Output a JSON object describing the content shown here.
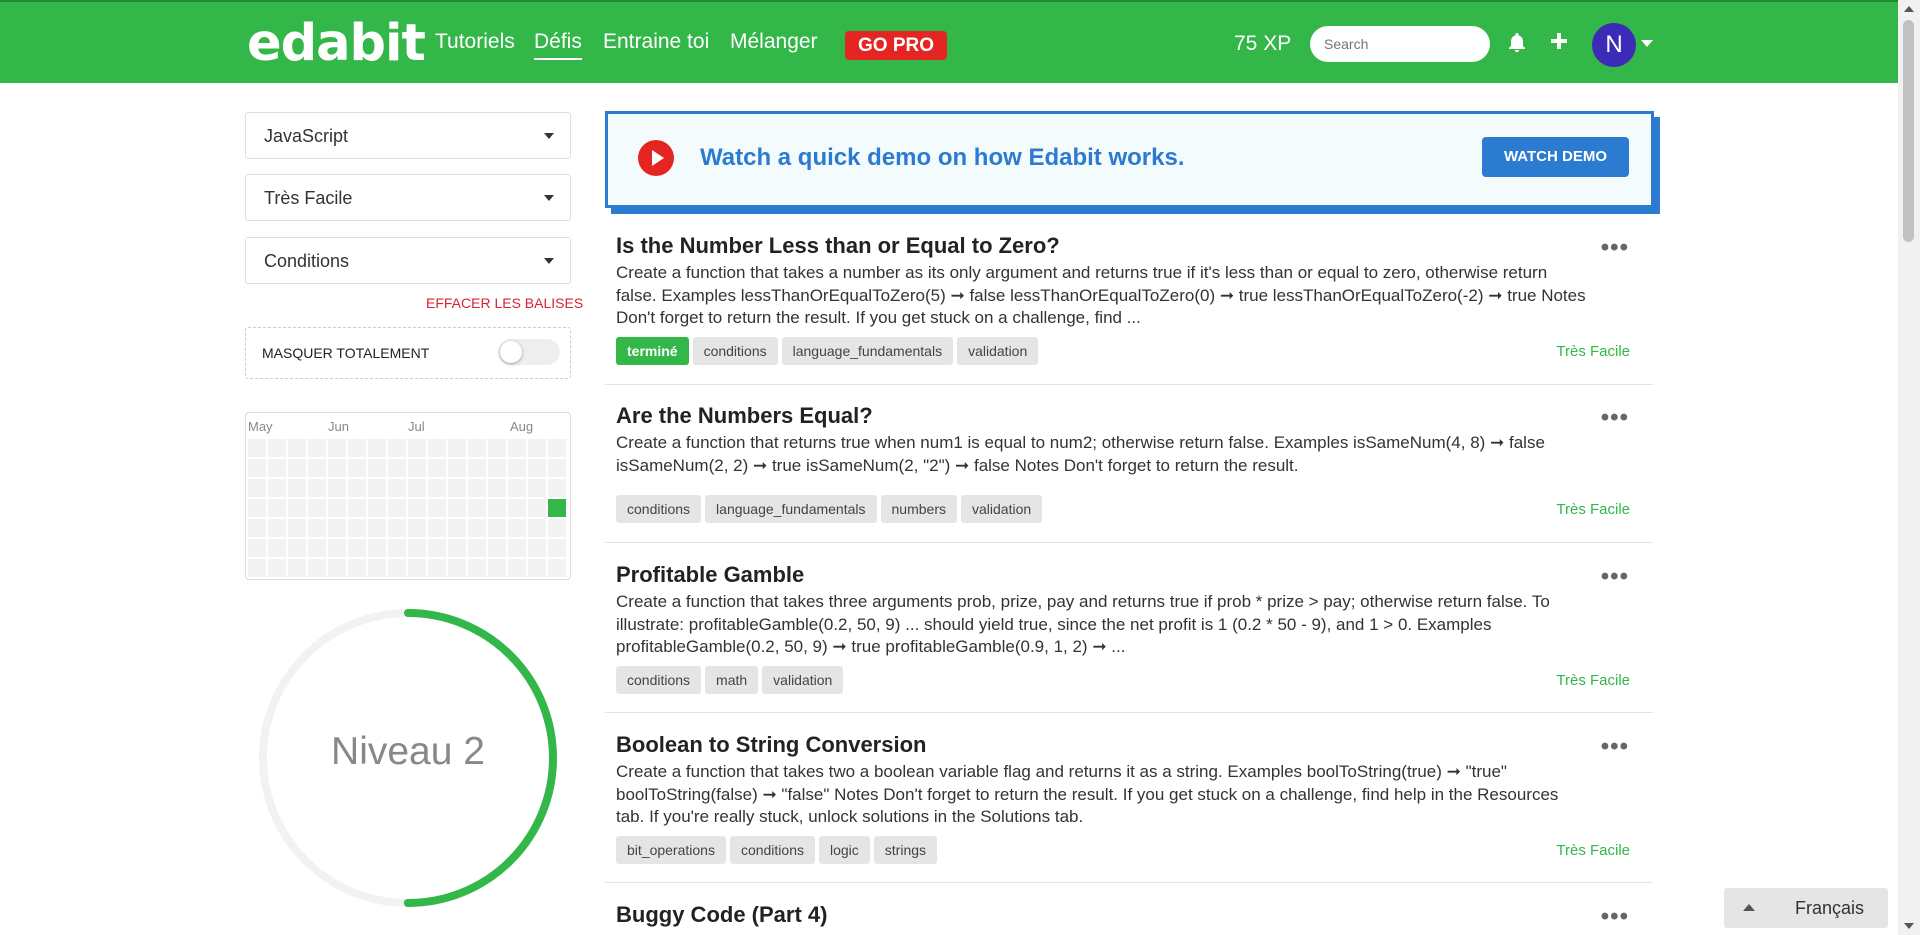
{
  "header": {
    "logo": "edabit",
    "nav": [
      "Tutoriels",
      "Défis",
      "Entraine toi",
      "Mélanger"
    ],
    "active_nav": "Défis",
    "gopro": "GO PRO",
    "xp": "75 XP",
    "search_placeholder": "Search",
    "avatar_initial": "N",
    "icons": [
      "bell-icon",
      "plus-icon",
      "chevron-down-icon"
    ]
  },
  "sidebar": {
    "language": "JavaScript",
    "difficulty": "Très Facile",
    "tag": "Conditions",
    "clear_tags": "EFFACER LES BALISES",
    "hide_label": "MASQUER TOTALEMENT",
    "hide_on": false,
    "heatmap_months": [
      "May",
      "Jun",
      "Jul",
      "Aug"
    ],
    "level_text": "Niveau 2",
    "level_progress": 0.5,
    "colors": {
      "accent": "#33b748",
      "ring_track": "#f2f2f2"
    }
  },
  "demo": {
    "text": "Watch a quick demo on how Edabit works.",
    "button": "WATCH DEMO",
    "color": "#2b7bd0"
  },
  "challenges": [
    {
      "title": "Is the Number Less than or Equal to Zero?",
      "desc": "Create a function that takes a number as its only argument and returns true if it's less than or equal to zero, otherwise return false. Examples lessThanOrEqualToZero(5) ➞ false lessThanOrEqualToZero(0) ➞ true lessThanOrEqualToZero(-2) ➞ true Notes Don't forget to return the result. If you get stuck on a challenge, find ...",
      "tags": [
        "terminé",
        "conditions",
        "language_fundamentals",
        "validation"
      ],
      "done": true,
      "difficulty": "Très Facile"
    },
    {
      "title": "Are the Numbers Equal?",
      "desc": "Create a function that returns true when num1 is equal to num2; otherwise return false. Examples isSameNum(4, 8) ➞ false isSameNum(2, 2) ➞ true isSameNum(2, \"2\") ➞ false Notes Don't forget to return the result.",
      "tags": [
        "conditions",
        "language_fundamentals",
        "numbers",
        "validation"
      ],
      "done": false,
      "difficulty": "Très Facile"
    },
    {
      "title": "Profitable Gamble",
      "desc": "Create a function that takes three arguments prob, prize, pay and returns true if prob * prize > pay; otherwise return false. To illustrate: profitableGamble(0.2, 50, 9) ... should yield true, since the net profit is 1 (0.2 * 50 - 9), and 1 > 0. Examples profitableGamble(0.2, 50, 9) ➞ true profitableGamble(0.9, 1, 2) ➞ ...",
      "tags": [
        "conditions",
        "math",
        "validation"
      ],
      "done": false,
      "difficulty": "Très Facile"
    },
    {
      "title": "Boolean to String Conversion",
      "desc": "Create a function that takes two a boolean variable flag and returns it as a string. Examples boolToString(true) ➞ \"true\" boolToString(false) ➞ \"false\" Notes Don't forget to return the result. If you get stuck on a challenge, find help in the Resources tab. If you're really stuck, unlock solutions in the Solutions tab.",
      "tags": [
        "bit_operations",
        "conditions",
        "logic",
        "strings"
      ],
      "done": false,
      "difficulty": "Très Facile"
    },
    {
      "title": "Buggy Code (Part 4)",
      "desc": "",
      "tags": [],
      "done": false,
      "difficulty": ""
    }
  ],
  "language_picker": "Français"
}
